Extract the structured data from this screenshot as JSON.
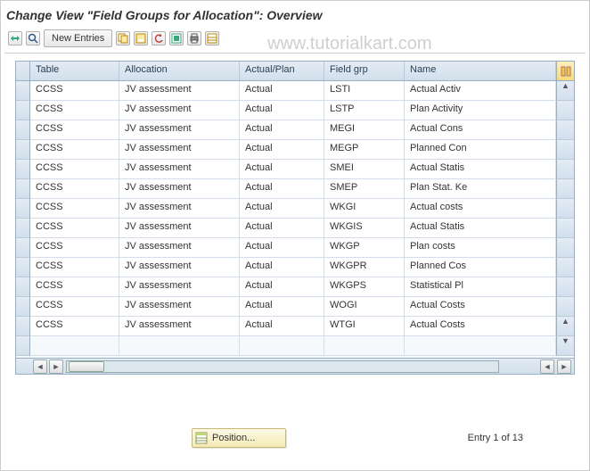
{
  "title": "Change View \"Field Groups for Allocation\": Overview",
  "watermark": "www.tutorialkart.com",
  "toolbar": {
    "new_entries": "New Entries"
  },
  "columns": {
    "table": "Table",
    "allocation": "Allocation",
    "actual_plan": "Actual/Plan",
    "field_grp": "Field grp",
    "name": "Name"
  },
  "rows": [
    {
      "table": "CCSS",
      "allocation": "JV assessment",
      "actual_plan": "Actual",
      "field_grp": "LSTI",
      "name": "Actual Activ"
    },
    {
      "table": "CCSS",
      "allocation": "JV assessment",
      "actual_plan": "Actual",
      "field_grp": "LSTP",
      "name": "Plan Activity"
    },
    {
      "table": "CCSS",
      "allocation": "JV assessment",
      "actual_plan": "Actual",
      "field_grp": "MEGI",
      "name": "Actual Cons"
    },
    {
      "table": "CCSS",
      "allocation": "JV assessment",
      "actual_plan": "Actual",
      "field_grp": "MEGP",
      "name": "Planned Con"
    },
    {
      "table": "CCSS",
      "allocation": "JV assessment",
      "actual_plan": "Actual",
      "field_grp": "SMEI",
      "name": "Actual Statis"
    },
    {
      "table": "CCSS",
      "allocation": "JV assessment",
      "actual_plan": "Actual",
      "field_grp": "SMEP",
      "name": "Plan Stat. Ke"
    },
    {
      "table": "CCSS",
      "allocation": "JV assessment",
      "actual_plan": "Actual",
      "field_grp": "WKGI",
      "name": "Actual costs"
    },
    {
      "table": "CCSS",
      "allocation": "JV assessment",
      "actual_plan": "Actual",
      "field_grp": "WKGIS",
      "name": "Actual Statis"
    },
    {
      "table": "CCSS",
      "allocation": "JV assessment",
      "actual_plan": "Actual",
      "field_grp": "WKGP",
      "name": "Plan costs"
    },
    {
      "table": "CCSS",
      "allocation": "JV assessment",
      "actual_plan": "Actual",
      "field_grp": "WKGPR",
      "name": "Planned Cos"
    },
    {
      "table": "CCSS",
      "allocation": "JV assessment",
      "actual_plan": "Actual",
      "field_grp": "WKGPS",
      "name": "Statistical Pl"
    },
    {
      "table": "CCSS",
      "allocation": "JV assessment",
      "actual_plan": "Actual",
      "field_grp": "WOGI",
      "name": "Actual Costs"
    },
    {
      "table": "CCSS",
      "allocation": "JV assessment",
      "actual_plan": "Actual",
      "field_grp": "WTGI",
      "name": "Actual Costs"
    }
  ],
  "position": {
    "label": "Position..."
  },
  "entry_text": "Entry 1 of 13"
}
